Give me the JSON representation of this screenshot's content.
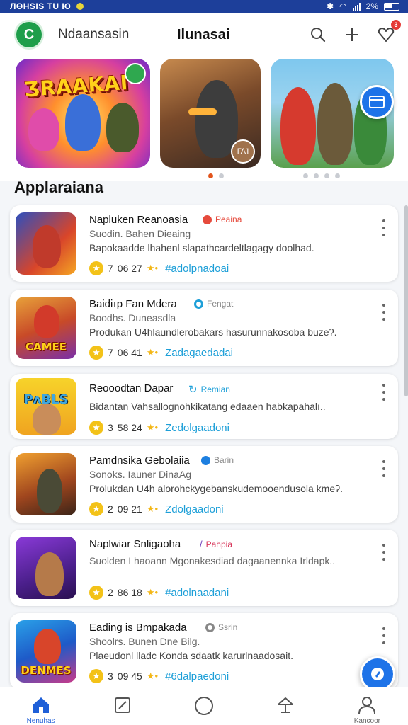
{
  "status_bar": {
    "text": "ЛΘHSIS TU Ю",
    "battery": "2%"
  },
  "header": {
    "avatar_letter": "C",
    "app_name": "Ndaansasin",
    "title": "Ilunasai",
    "notification_count": "3"
  },
  "carousel": {
    "banners": [
      {
        "title": "ƷRAAKAI"
      },
      {
        "badge": "ΓΛΊ"
      },
      {}
    ]
  },
  "section_title": "Applaraiana",
  "apps": [
    {
      "title": "Napluken Reanoasia",
      "tag": "Peaina",
      "tag_color": "#e64a3c",
      "subtitle": "Suodin. Bahen Dieaing",
      "desc": "Bapokaadde lhahenl slapathcardeltlagagy doolhad.",
      "rating": "7",
      "meta": "06 27",
      "link": "#adolpnadoai",
      "thumb_label": ""
    },
    {
      "title": "Baidiɪp Fan Mdera",
      "tag": "Fengat",
      "tag_color": "#888888",
      "subtitle": "Boodhs. Duneasdla",
      "desc": "Produkan U4hlaundlerobakars hasurunnakosoba buzeʔ.",
      "rating": "7",
      "meta": "06 41",
      "link": "Zadagaedadai",
      "thumb_label": "CAMEE"
    },
    {
      "title": "Reooodtan Dapar",
      "tag": "Remian",
      "tag_color": "#1d9fd8",
      "subtitle": "",
      "desc": "Bidantan Vahsallognohkikatang edaaen habkapahalı..",
      "rating": "3",
      "meta": "58 24",
      "link": "Zedolgaadoni",
      "thumb_label": "PᴧBLS"
    },
    {
      "title": "Pamdnsika Gebolaiia",
      "tag": "Barin",
      "tag_color": "#888888",
      "subtitle": "Sonoks. Iauner DinaAg",
      "desc": "Prolukdan U4h alorohckygebanskudemooendusola kmeʔ.",
      "rating": "2",
      "meta": "09 21",
      "link": "Zdolgaadoni",
      "thumb_label": ""
    },
    {
      "title": "Naplwiar Snligaoha",
      "tag": "Pahpia",
      "tag_color": "#d8365a",
      "subtitle": "Suolden I haoann Mgonakesdiad dagaanennka Irldapk..",
      "desc": "",
      "rating": "2",
      "meta": "86 18",
      "link": "#adolnaadani",
      "thumb_label": ""
    },
    {
      "title": "Eading is Bmpakada",
      "tag": "Ssrin",
      "tag_color": "#888888",
      "subtitle": "Shoolrs. Bunen Dne Bilg.",
      "desc": "Plaeudonl lladc Konda sdaatk karurlnaadosait.",
      "rating": "3",
      "meta": "09 45",
      "link": "#6dalpaedoni",
      "thumb_label": "DENMES"
    }
  ],
  "nav": [
    {
      "label": "Nenuhas",
      "icon": "home-icon"
    },
    {
      "label": "",
      "icon": "edit-square-icon"
    },
    {
      "label": "",
      "icon": "circle-icon"
    },
    {
      "label": "",
      "icon": "trophy-icon"
    },
    {
      "label": "Kancoor",
      "icon": "profile-icon"
    }
  ],
  "colors": {
    "accent": "#1e73e8",
    "status_bar": "#1d3f9a",
    "link": "#1d9fd8",
    "avatar": "#1e9e4a"
  }
}
